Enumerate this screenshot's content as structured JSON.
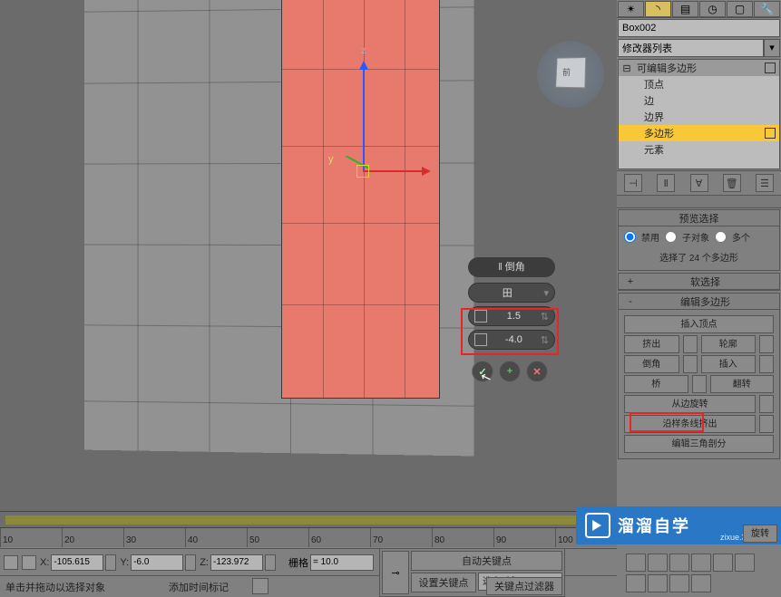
{
  "object_name": "Box002",
  "modifier_dropdown": "修改器列表",
  "modifier_stack": {
    "top": "可编辑多边形",
    "sub_items": [
      "顶点",
      "边",
      "边界",
      "多边形",
      "元素"
    ],
    "selected": "多边形"
  },
  "caddy": {
    "title": "‖ 倒角",
    "mode_icon": "田",
    "height": "1.5",
    "outline": "-4.0"
  },
  "preview": {
    "header": "预览选择",
    "opt_disable": "禁用",
    "opt_subobj": "子对象",
    "opt_multi": "多个",
    "selection_info": "选择了 24 个多边形"
  },
  "rollup_softsel": {
    "pm": "+",
    "title": "软选择"
  },
  "rollup_editpoly": {
    "pm": "-",
    "title": "编辑多边形"
  },
  "edit_poly": {
    "insert_vertex": "插入顶点",
    "extrude": "挤出",
    "outline": "轮廓",
    "chamfer": "倒角",
    "inset": "插入",
    "bridge": "桥",
    "flip": "翻转",
    "spin_edge": "从边旋转",
    "extrude_spline": "沿样条线挤出",
    "edit_tri": "编辑三角剖分",
    "rot_suffix": "旋转"
  },
  "coords": {
    "x_label": "X:",
    "x": "-105.615",
    "y_label": "Y:",
    "y": "-6.0",
    "z_label": "Z:",
    "z": "-123.972",
    "grid_label": "栅格",
    "grid": "= 10.0"
  },
  "status": {
    "left": "单击并拖动以选择对象",
    "mid": "添加时间标记"
  },
  "keys": {
    "auto": "自动关键点",
    "set": "设置关键点",
    "selected": "选定对象",
    "filter": "关键点过滤器"
  },
  "ruler": [
    "10",
    "20",
    "30",
    "40",
    "50",
    "60",
    "70",
    "80",
    "90",
    "100"
  ],
  "watermark": {
    "brand": "溜溜自学",
    "url": "zixue.3d66.com"
  }
}
